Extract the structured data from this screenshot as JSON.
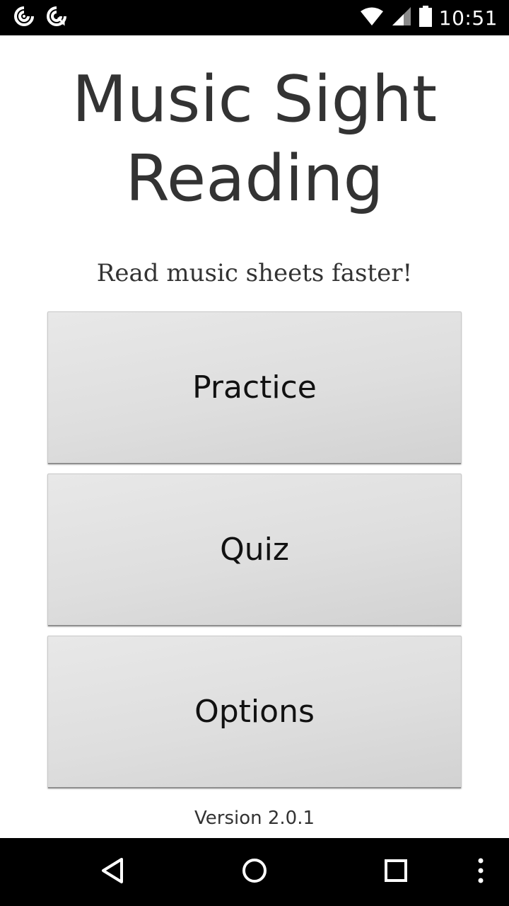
{
  "status_bar": {
    "time": "10:51",
    "icons": [
      "sync-icon",
      "sync-alert-icon",
      "wifi-icon",
      "signal-icon",
      "battery-icon"
    ]
  },
  "app": {
    "title_line1": "Music Sight",
    "title_line2": "Reading",
    "tagline": "Read music sheets faster!",
    "version": "Version 2.0.1"
  },
  "menu": {
    "practice_label": "Practice",
    "quiz_label": "Quiz",
    "options_label": "Options"
  },
  "nav_bar": {
    "icons": [
      "back-icon",
      "home-icon",
      "recents-icon",
      "overflow-menu-icon"
    ]
  },
  "colors": {
    "status_bar": "#000000",
    "nav_bar": "#000000",
    "background": "#ffffff",
    "button_face": "#dedede",
    "text": "#333333"
  }
}
